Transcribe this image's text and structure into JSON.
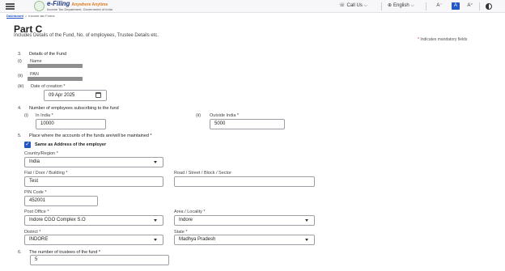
{
  "header": {
    "logo_title": "e-Filing",
    "logo_suffix": "Anywhere Anytime",
    "logo_tagline": "Income Tax Department, Government of India",
    "call_us": "Call Us",
    "language": "English",
    "font_small": "A⁻",
    "font_normal": "A",
    "font_large": "A⁺"
  },
  "breadcrumb": {
    "home": "Dashboard",
    "sep": ">",
    "current": "Income-tax Forms"
  },
  "page": {
    "title": "Part C",
    "subtitle": "Includes Details of the Fund, No. of employees, Trustee Details etc.",
    "mandatory_note": "Indicates mandatory fields"
  },
  "section3": {
    "num": "3.",
    "title": "Details of the Fund",
    "i": {
      "num": "(i)",
      "label": "Name"
    },
    "ii": {
      "num": "(ii)",
      "label": "PAN"
    },
    "iii": {
      "num": "(iii)",
      "label": "Date of creation *",
      "value": "09 Apr 2025"
    }
  },
  "section4": {
    "num": "4.",
    "title": "Number of employees subscribing to the fund",
    "i": {
      "num": "(i)",
      "label": "In India *",
      "value": "10000"
    },
    "ii": {
      "num": "(ii)",
      "label": "Outside India *",
      "value": "5000"
    }
  },
  "section5": {
    "num": "5.",
    "title": "Place where the accounts of the funds are/will be maintained *",
    "same_address_label": "Same as Address of the employer",
    "country": {
      "label": "Country/Region *",
      "value": "India"
    },
    "flat": {
      "label": "Flat / Door / Building *",
      "value": "Test"
    },
    "road": {
      "label": "Road / Street / Block / Sector",
      "value": ""
    },
    "pin": {
      "label": "PIN Code *",
      "value": "452001"
    },
    "post_office": {
      "label": "Post Office *",
      "value": "Indore CGO Complex S.O"
    },
    "area": {
      "label": "Area / Locality *",
      "value": "Indore"
    },
    "district": {
      "label": "District *",
      "value": "INDORE"
    },
    "state": {
      "label": "State *",
      "value": "Madhya Pradesh"
    }
  },
  "section6": {
    "num": "6.",
    "title": "The number of trustees of the fund *",
    "value": "5"
  }
}
